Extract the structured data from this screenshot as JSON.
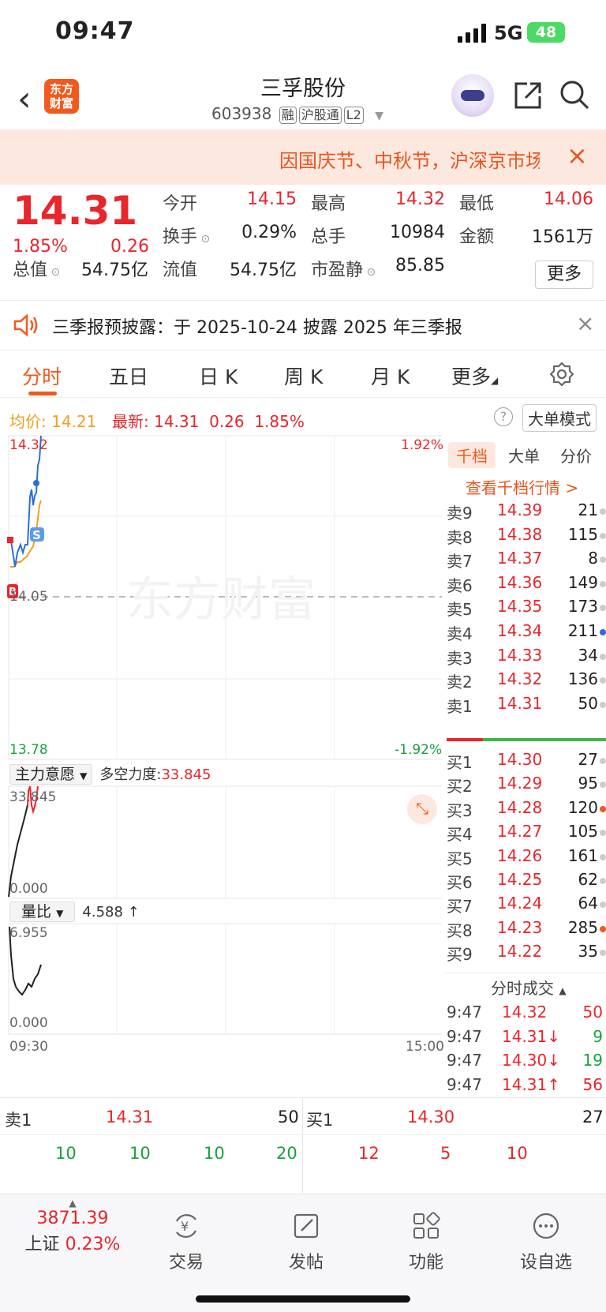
{
  "status": {
    "time": "09:47",
    "network": "5G",
    "battery": "48"
  },
  "nav": {
    "title": "三孚股份",
    "code": "603938",
    "tags": [
      "融",
      "沪股通",
      "L2"
    ],
    "logo": "东方\n财富"
  },
  "notice": {
    "text": "因国庆节、中秋节，沪深京市场"
  },
  "quote": {
    "price": "14.31",
    "pct": "1.85%",
    "change": "0.26",
    "fields": [
      {
        "label": "今开",
        "value": "14.15",
        "color": "red"
      },
      {
        "label": "最高",
        "value": "14.32",
        "color": "red"
      },
      {
        "label": "最低",
        "value": "14.06",
        "color": "red"
      },
      {
        "label": "换手",
        "value": "0.29%",
        "color": "black"
      },
      {
        "label": "总手",
        "value": "10984",
        "color": "black"
      },
      {
        "label": "金额",
        "value": "1561万",
        "color": "black"
      },
      {
        "label": "总值",
        "value": "54.75亿",
        "color": "black"
      },
      {
        "label": "流值",
        "value": "54.75亿",
        "color": "black"
      },
      {
        "label": "市盈静",
        "value": "85.85",
        "color": "black"
      }
    ],
    "more": "更多"
  },
  "report": {
    "text": "三季报预披露：于 2025-10-24 披露 2025 年三季报"
  },
  "tabs": [
    "分时",
    "五日",
    "日 K",
    "周 K",
    "月 K",
    "更多"
  ],
  "avg": {
    "avg_label": "均价:",
    "avg": "14.21",
    "latest_label": "最新:",
    "latest": "14.31",
    "chg": "0.26",
    "pct": "1.85%",
    "bigmode": "大单模式"
  },
  "chart": {
    "ymax": "14.32",
    "ymax_pct": "1.92%",
    "ymid": "14.05",
    "ymin": "13.78",
    "ymin_pct": "-1.92%",
    "watermark": "东方财富",
    "x_start": "09:30",
    "x_end": "15:00",
    "ind1_label": "主力意愿",
    "ind1_name": "多空力度:",
    "ind1_value": "33.845",
    "ind1_top": "33.845",
    "ind1_bottom": "0.000",
    "ind2_label": "量比",
    "ind2_value": "4.588 ↑",
    "ind2_top": "6.955",
    "ind2_bottom": "0.000"
  },
  "book": {
    "tabs": [
      "千档",
      "大单",
      "分价"
    ],
    "link": "查看千档行情 >",
    "sell": [
      {
        "n": "卖9",
        "p": "14.39",
        "q": "21",
        "dot": "#ccc"
      },
      {
        "n": "卖8",
        "p": "14.38",
        "q": "115",
        "dot": "#ccc"
      },
      {
        "n": "卖7",
        "p": "14.37",
        "q": "8",
        "dot": "#ccc"
      },
      {
        "n": "卖6",
        "p": "14.36",
        "q": "149",
        "dot": "#ccc"
      },
      {
        "n": "卖5",
        "p": "14.35",
        "q": "173",
        "dot": "#ccc"
      },
      {
        "n": "卖4",
        "p": "14.34",
        "q": "211",
        "dot": "#2a6fdb"
      },
      {
        "n": "卖3",
        "p": "14.33",
        "q": "34",
        "dot": "#ccc"
      },
      {
        "n": "卖2",
        "p": "14.32",
        "q": "136",
        "dot": "#ccc"
      },
      {
        "n": "卖1",
        "p": "14.31",
        "q": "50",
        "dot": "#ccc"
      }
    ],
    "buy": [
      {
        "n": "买1",
        "p": "14.30",
        "q": "27",
        "dot": "#ccc"
      },
      {
        "n": "买2",
        "p": "14.29",
        "q": "95",
        "dot": "#ccc"
      },
      {
        "n": "买3",
        "p": "14.28",
        "q": "120",
        "dot": "#f25a1d"
      },
      {
        "n": "买4",
        "p": "14.27",
        "q": "105",
        "dot": "#ccc"
      },
      {
        "n": "买5",
        "p": "14.26",
        "q": "161",
        "dot": "#ccc"
      },
      {
        "n": "买6",
        "p": "14.25",
        "q": "62",
        "dot": "#ccc"
      },
      {
        "n": "买7",
        "p": "14.24",
        "q": "64",
        "dot": "#ccc"
      },
      {
        "n": "买8",
        "p": "14.23",
        "q": "285",
        "dot": "#f25a1d"
      },
      {
        "n": "买9",
        "p": "14.22",
        "q": "35",
        "dot": "#ccc"
      }
    ],
    "ticks_title": "分时成交",
    "ticks": [
      {
        "t": "9:47",
        "p": "14.32",
        "q": "50",
        "qc": "red"
      },
      {
        "t": "9:47",
        "p": "14.31↓",
        "q": "9",
        "qc": "green"
      },
      {
        "t": "9:47",
        "p": "14.30↓",
        "q": "19",
        "qc": "green"
      },
      {
        "t": "9:47",
        "p": "14.31↑",
        "q": "56",
        "qc": "red"
      }
    ]
  },
  "bottom_quote": {
    "sell_label": "卖1",
    "sell_price": "14.31",
    "sell_qty": "50",
    "buy_label": "买1",
    "buy_price": "14.30",
    "buy_qty": "27",
    "sell_split": [
      "10",
      "10",
      "10",
      "20"
    ],
    "buy_split": [
      "12",
      "5",
      "10"
    ]
  },
  "bottom_nav": {
    "index_value": "3871.39",
    "index_name": "上证",
    "index_pct": "0.23%",
    "items": [
      "交易",
      "发帖",
      "功能",
      "设自选"
    ]
  }
}
